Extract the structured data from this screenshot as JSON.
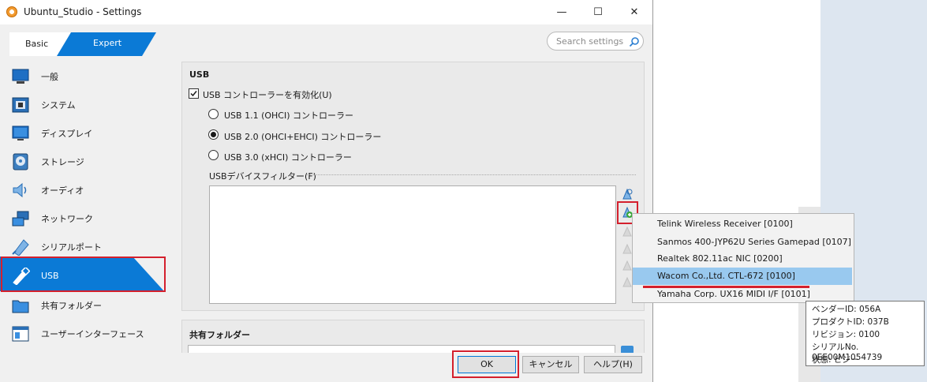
{
  "window": {
    "title": "Ubuntu_Studio - Settings",
    "controls": {
      "minimize": "—",
      "maximize": "☐",
      "close": "✕"
    }
  },
  "mode_tabs": {
    "basic": "Basic",
    "expert": "Expert",
    "selected": "Expert"
  },
  "search": {
    "placeholder": "Search settings"
  },
  "sidebar": {
    "selected": "USB",
    "items": [
      {
        "label": "一般",
        "icon": "general-icon"
      },
      {
        "label": "システム",
        "icon": "system-icon"
      },
      {
        "label": "ディスプレイ",
        "icon": "display-icon"
      },
      {
        "label": "ストレージ",
        "icon": "storage-icon"
      },
      {
        "label": "オーディオ",
        "icon": "audio-icon"
      },
      {
        "label": "ネットワーク",
        "icon": "network-icon"
      },
      {
        "label": "シリアルポート",
        "icon": "serial-port-icon"
      },
      {
        "label": "USB",
        "icon": "usb-icon"
      },
      {
        "label": "共有フォルダー",
        "icon": "shared-folder-icon"
      },
      {
        "label": "ユーザーインターフェース",
        "icon": "user-interface-icon"
      }
    ]
  },
  "usb": {
    "group_title": "USB",
    "enable_label": "USB コントローラーを有効化(U)",
    "enabled": true,
    "controllers": [
      {
        "label": "USB 1.1 (OHCI) コントローラー",
        "selected": false
      },
      {
        "label": "USB 2.0 (OHCI+EHCI) コントローラー",
        "selected": true
      },
      {
        "label": "USB 3.0 (xHCI) コントローラー",
        "selected": false
      }
    ],
    "filter_label": "USBデバイスフィルター(F)"
  },
  "shared_folders": {
    "group_title": "共有フォルダー"
  },
  "buttons": {
    "ok": "OK",
    "cancel": "キャンセル",
    "help": "ヘルプ(H)"
  },
  "device_menu": {
    "highlighted": "Wacom Co.,Ltd. CTL-672 [0100]",
    "items": [
      "Telink Wireless Receiver [0100]",
      "Sanmos 400-JYP62U Series Gamepad [0107]",
      "Realtek 802.11ac NIC [0200]",
      "Wacom Co.,Ltd. CTL-672 [0100]",
      "Yamaha Corp. UX16 MIDI I/F [0101]"
    ]
  },
  "tooltip": {
    "lines": [
      "ベンダーID: 056A",
      "プロダクトID: 037B",
      "リビジョン: 0100",
      "シリアルNo. 0EE00M1054739",
      "状態: ビジー"
    ]
  },
  "colors": {
    "accent": "#0078d7",
    "highlight_red": "#d4202d",
    "menu_highlight": "#99c9ef"
  }
}
